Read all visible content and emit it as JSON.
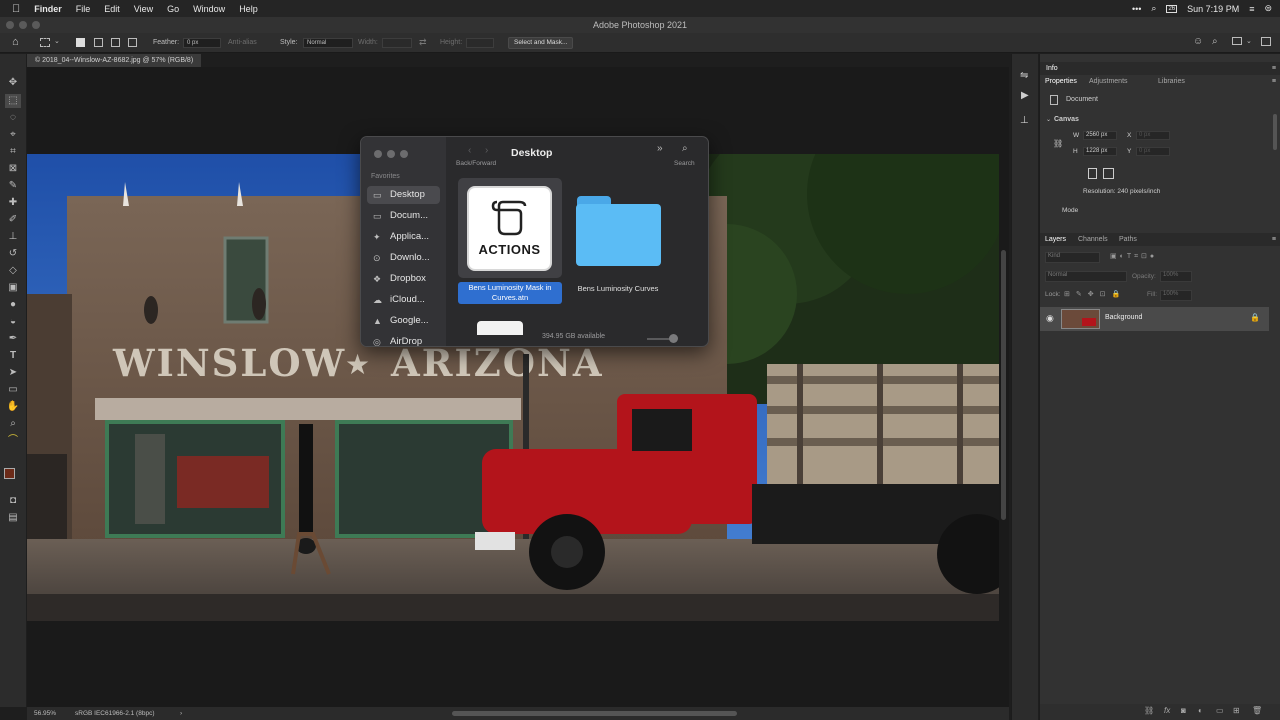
{
  "menubar": {
    "apple": "",
    "app": "Finder",
    "items": [
      "File",
      "Edit",
      "View",
      "Go",
      "Window",
      "Help"
    ],
    "clock": "Sun 7:19 PM",
    "calendar_day": "26"
  },
  "window": {
    "title": "Adobe Photoshop 2021"
  },
  "options": {
    "feather_label": "Feather:",
    "feather_value": "0 px",
    "antialias": "Anti-alias",
    "style_label": "Style:",
    "style_value": "Normal",
    "width_label": "Width:",
    "height_label": "Height:",
    "select_mask": "Select and Mask..."
  },
  "document": {
    "tab": "© 2018_04--Winslow-AZ-8682.jpg @ 57% (RGB/8)"
  },
  "status": {
    "zoom": "56.95%",
    "profile": "sRGB IEC61966-2.1 (8bpc)"
  },
  "panels": {
    "info_tab": "Info",
    "properties_tabs": [
      "Properties",
      "Adjustments",
      "Libraries"
    ],
    "doc_label": "Document",
    "canvas_label": "Canvas",
    "w_label": "W",
    "w_value": "2560 px",
    "h_label": "H",
    "h_value": "1228 px",
    "x_label": "X",
    "x_placeholder": "0 px",
    "y_label": "Y",
    "y_placeholder": "0 px",
    "resolution": "Resolution: 240 pixels/inch",
    "mode": "Mode",
    "layers_tabs": [
      "Layers",
      "Channels",
      "Paths"
    ],
    "kind": "Kind",
    "blend": "Normal",
    "opacity_label": "Opacity:",
    "opacity_value": "100%",
    "lock_label": "Lock:",
    "fill_label": "Fill:",
    "fill_value": "100%",
    "layer_name": "Background"
  },
  "finder": {
    "title": "Desktop",
    "back_forward": "Back/Forward",
    "search": "Search",
    "favorites": "Favorites",
    "sidebar": [
      {
        "label": "Desktop",
        "icon": "desktop-icon"
      },
      {
        "label": "Docum...",
        "icon": "document-icon"
      },
      {
        "label": "Applica...",
        "icon": "applications-icon"
      },
      {
        "label": "Downlo...",
        "icon": "downloads-icon"
      },
      {
        "label": "Dropbox",
        "icon": "dropbox-icon"
      },
      {
        "label": "iCloud...",
        "icon": "icloud-icon"
      },
      {
        "label": "Google...",
        "icon": "google-drive-icon"
      },
      {
        "label": "AirDrop",
        "icon": "airdrop-icon"
      }
    ],
    "files": [
      {
        "name": "Bens Luminosity Mask in Curves.atn",
        "icon_text": "ACTIONS"
      },
      {
        "name": "Bens Luminosity Curves"
      }
    ],
    "storage": "394.95 GB available"
  },
  "photo": {
    "sign_left": "WINSLOW",
    "sign_star": "★",
    "sign_right": "ARIZONA"
  }
}
